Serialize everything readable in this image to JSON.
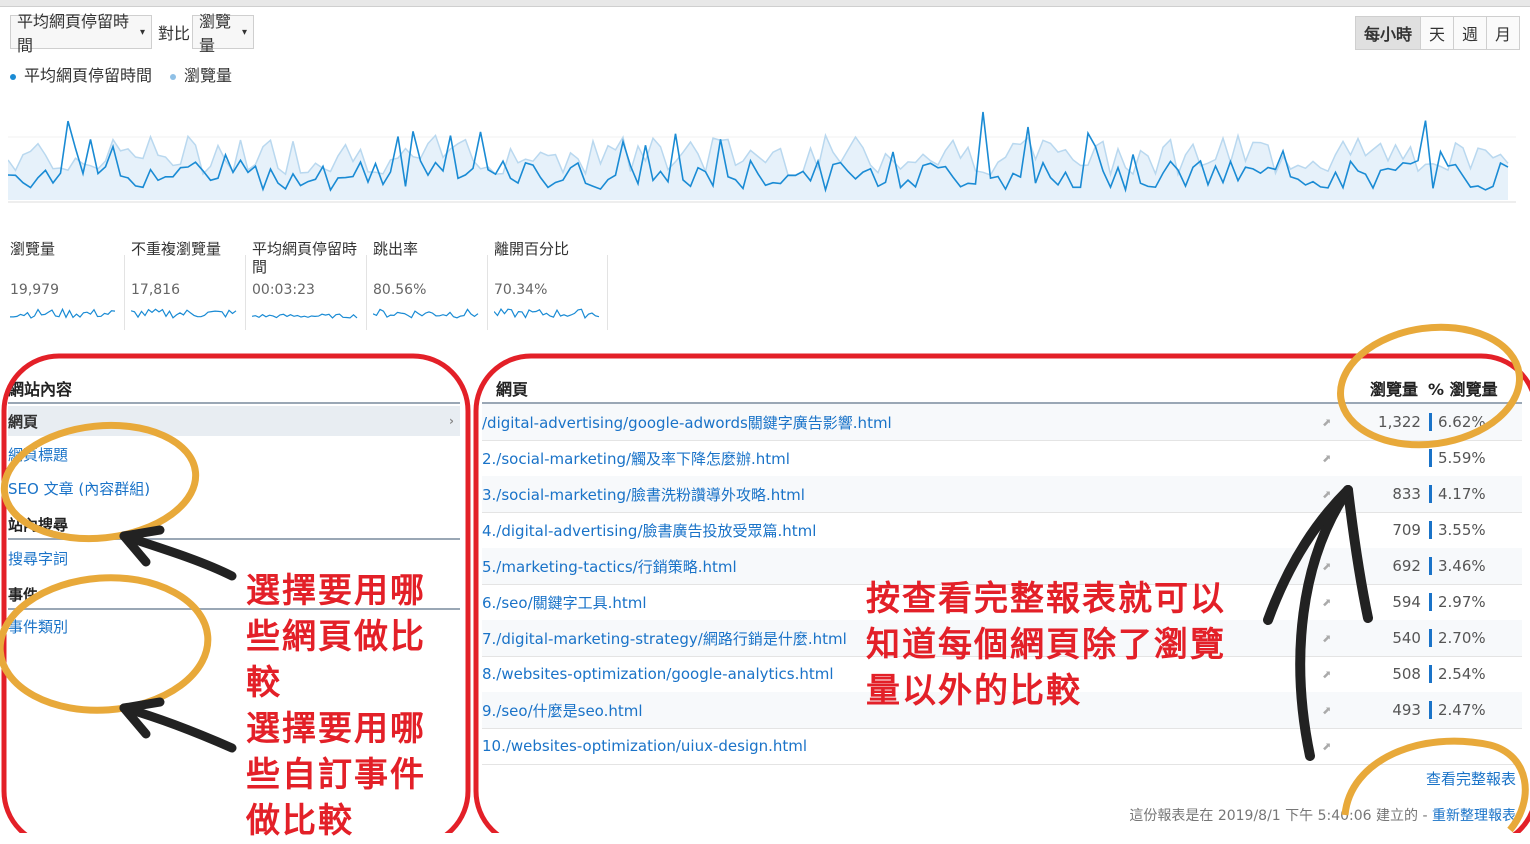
{
  "controls": {
    "primary_metric": "平均網頁停留時間",
    "compare_label": "對比",
    "secondary_metric": "瀏覽量",
    "granularity": [
      "每小時",
      "天",
      "週",
      "月"
    ]
  },
  "legend": [
    {
      "label": "平均網頁停留時間",
      "color": "#1a8bd4"
    },
    {
      "label": "瀏覽量",
      "color": "#8fc0e6"
    }
  ],
  "metrics": [
    {
      "label": "瀏覽量",
      "value": "19,979"
    },
    {
      "label": "不重複瀏覽量",
      "value": "17,816"
    },
    {
      "label": "平均網頁停留時間",
      "value": "00:03:23"
    },
    {
      "label": "跳出率",
      "value": "80.56%"
    },
    {
      "label": "離開百分比",
      "value": "70.34%"
    }
  ],
  "left_panel": {
    "header": "網站內容",
    "selected": "網頁",
    "items": [
      "網頁標題",
      "SEO 文章 (內容群組)"
    ],
    "section_search": "站內搜尋",
    "search_item": "搜尋字詞",
    "section_events": "事件",
    "events_item": "事件類別"
  },
  "right_panel": {
    "header_page": "網頁",
    "header_views": "瀏覽量",
    "header_pct": "% 瀏覽量",
    "rows": [
      {
        "path": "/digital-advertising/google-adwords關鍵字廣告影響.html",
        "views": "1,322",
        "pct": "6.62%"
      },
      {
        "path": "2./social-marketing/觸及率下降怎麼辦.html",
        "views": "",
        "pct": "5.59%"
      },
      {
        "path": "3./social-marketing/臉書洗粉讚導外攻略.html",
        "views": "833",
        "pct": "4.17%"
      },
      {
        "path": "4./digital-advertising/臉書廣告投放受眾篇.html",
        "views": "709",
        "pct": "3.55%"
      },
      {
        "path": "5./marketing-tactics/行銷策略.html",
        "views": "692",
        "pct": "3.46%"
      },
      {
        "path": "6./seo/關鍵字工具.html",
        "views": "594",
        "pct": "2.97%"
      },
      {
        "path": "7./digital-marketing-strategy/網路行銷是什麼.html",
        "views": "540",
        "pct": "2.70%"
      },
      {
        "path": "8./websites-optimization/google-analytics.html",
        "views": "508",
        "pct": "2.54%"
      },
      {
        "path": "9./seo/什麼是seo.html",
        "views": "493",
        "pct": "2.47%"
      },
      {
        "path": "10./websites-optimization/uiux-design.html",
        "views": "",
        "pct": ""
      }
    ],
    "full_report_link": "查看完整報表",
    "footer_text": "這份報表是在 2019/8/1 下午 5:40:06 建立的 -",
    "refresh_link": "重新整理報表"
  },
  "annotations": {
    "left_a_lines": [
      "選擇要用哪",
      "些網頁做比",
      "較"
    ],
    "left_b_lines": [
      "選擇要用哪",
      "些自訂事件",
      "做比較"
    ],
    "right_lines": [
      "按查看完整報表就可以",
      "知道每個網頁除了瀏覽",
      "量以外的比較"
    ]
  },
  "colors": {
    "annotation_red": "#e32028",
    "highlight_orange": "#e8a93a",
    "link_blue": "#1a73c8"
  }
}
